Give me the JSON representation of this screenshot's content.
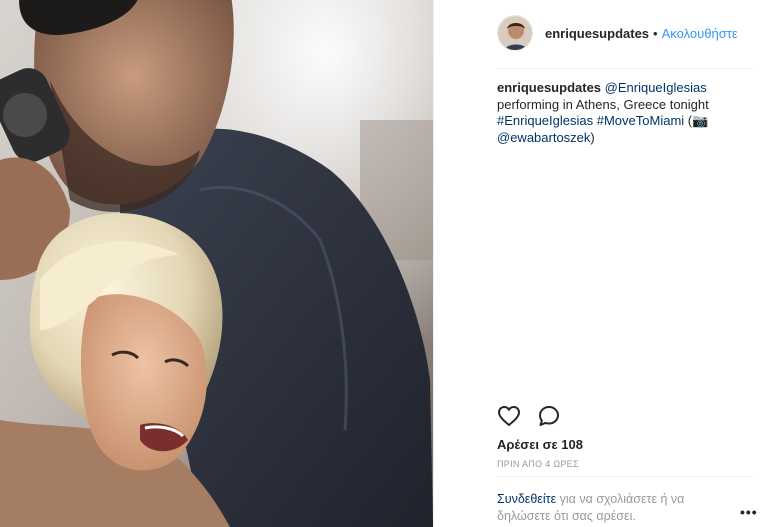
{
  "post": {
    "username": "enriquesupdates",
    "header_separator": "•",
    "follow_label": "Ακολουθήστε",
    "caption": {
      "username": "enriquesupdates",
      "mention": "@EnriqueIglesias",
      "line1_rest": "performing in Athens, Greece tonight",
      "hashtag1": "#EnriqueIglesias",
      "hashtag2": "#MoveToMiami",
      "camera_open": "(",
      "camera_emoji": "📷",
      "photo_credit": "@ewabartoszek",
      "close": ")"
    },
    "likes_text": "Αρέσει σε 108",
    "timestamp": "ΠΡΙΝ ΑΠΟ 4 ΩΡΕΣ",
    "comment_prompt": {
      "login_link": "Συνδεθείτε",
      "rest": "για να σχολιάσετε ή να δηλώσετε ότι σας αρέσει."
    },
    "more_options_label": "•••"
  },
  "icons": {
    "like": "heart-icon",
    "comment": "speech-bubble-icon",
    "camera": "camera-icon"
  },
  "colors": {
    "accent": "#3897f0",
    "link": "#003569",
    "muted": "#999999",
    "text": "#262626"
  }
}
